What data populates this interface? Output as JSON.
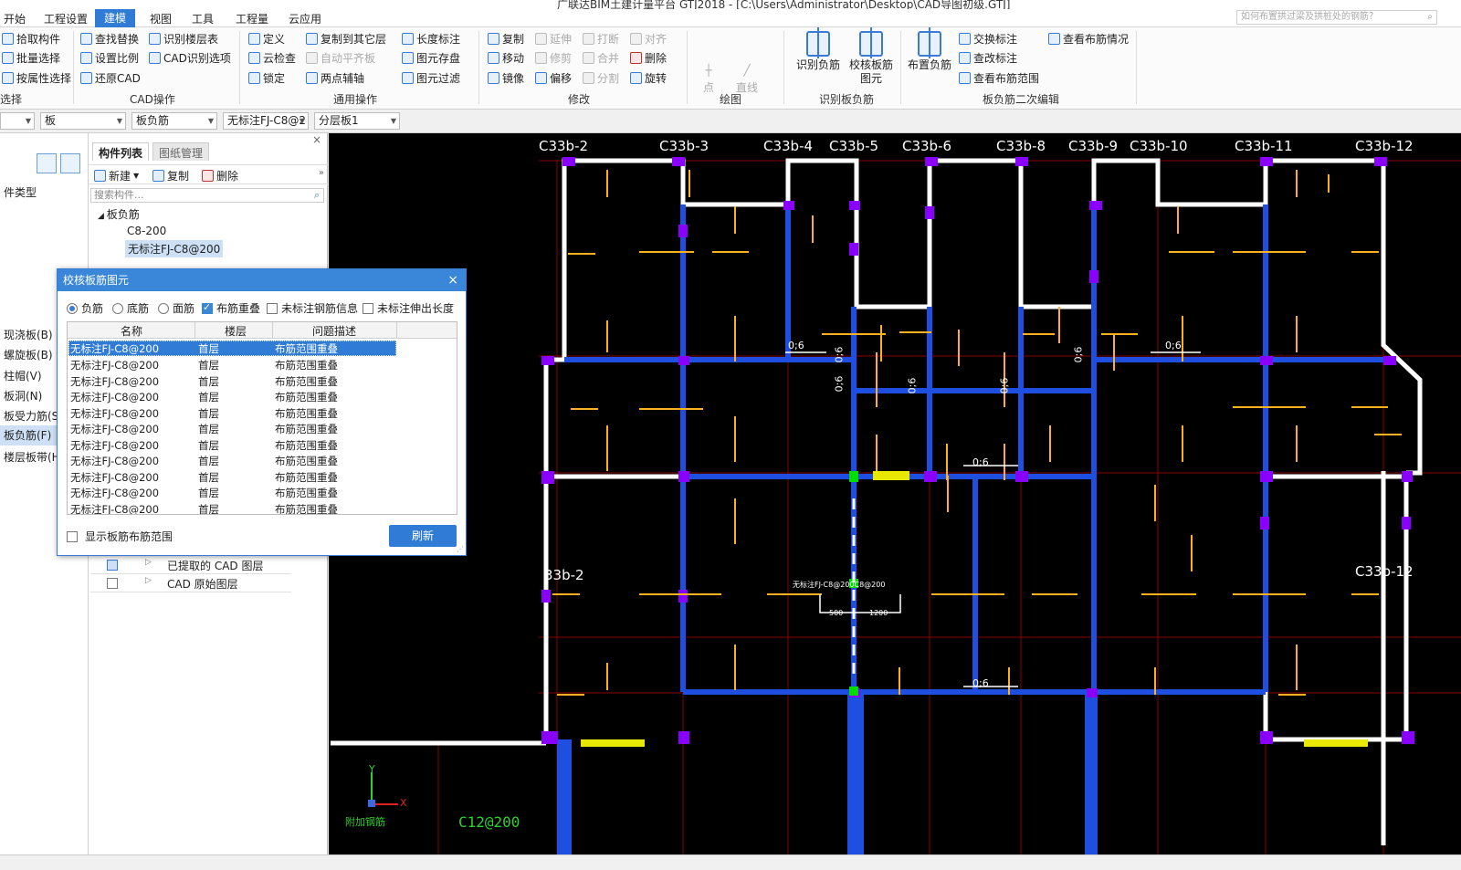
{
  "window": {
    "title": "广联达BIM土建计量平台 GTJ2018 - [C:\\Users\\Administrator\\Desktop\\CAD导图初级.GTJ]"
  },
  "menu": {
    "items": [
      "开始",
      "工程设置",
      "建模",
      "视图",
      "工具",
      "工程量",
      "云应用"
    ],
    "active": "建模",
    "search_placeholder": "如何布置拱过梁及拱桩处的钢筋？"
  },
  "ribbon": {
    "select_group": {
      "items": [
        "拾取构件",
        "批量选择",
        "按属性选择"
      ],
      "label": "选择"
    },
    "cad_group": {
      "items": [
        "查找替换",
        "识别楼层表",
        "设置比例",
        "CAD识别选项",
        "还原CAD"
      ],
      "label": "CAD操作"
    },
    "common_group": {
      "items": [
        "定义",
        "复制到其它层",
        "长度标注",
        "云检查",
        "自动平齐板",
        "图元存盘",
        "锁定",
        "两点辅轴",
        "图元过滤"
      ],
      "label": "通用操作"
    },
    "modify_group": {
      "items": [
        "复制",
        "延伸",
        "打断",
        "对齐",
        "移动",
        "修剪",
        "合并",
        "删除",
        "镜像",
        "偏移",
        "分割",
        "旋转"
      ],
      "label": "修改"
    },
    "draw_group": {
      "items": [
        "点",
        "直线"
      ],
      "label": "绘图"
    },
    "recognize_group": {
      "items": [
        "识别负筋",
        "校核板筋图元"
      ],
      "label": "识别板负筋"
    },
    "edit_group": {
      "items": [
        "布置负筋",
        "交换标注",
        "查看布筋情况",
        "查改标注",
        "查看布筋范围"
      ],
      "label": "板负筋二次编辑"
    }
  },
  "propbar": {
    "combos": [
      "",
      "板",
      "板负筋",
      "无标注FJ-C8@2",
      "分层板1"
    ]
  },
  "left_panel": {
    "header": "件类型",
    "items": [
      "现浇板(B)",
      "螺旋板(B)",
      "柱帽(V)",
      "板洞(N)",
      "板受力筋(S)",
      "板负筋(F)",
      "楼层板带(H)"
    ],
    "selected": "板负筋(F)"
  },
  "component_panel": {
    "tabs": [
      "构件列表",
      "图纸管理"
    ],
    "tools": [
      "新建",
      "复制",
      "删除"
    ],
    "search_placeholder": "搜索构件...",
    "tree_root": "板负筋",
    "tree_children": [
      "C8-200",
      "无标注FJ-C8@200"
    ],
    "selected": "无标注FJ-C8@200",
    "layers": [
      "已提取的 CAD 图层",
      "CAD 原始图层"
    ]
  },
  "dialog": {
    "title": "校核板筋图元",
    "options": [
      {
        "label": "负筋",
        "type": "radio",
        "checked": true
      },
      {
        "label": "底筋",
        "type": "radio",
        "checked": false
      },
      {
        "label": "面筋",
        "type": "radio",
        "checked": false
      },
      {
        "label": "布筋重叠",
        "type": "checkbox",
        "checked": true
      },
      {
        "label": "未标注钢筋信息",
        "type": "checkbox",
        "checked": false
      },
      {
        "label": "未标注伸出长度",
        "type": "checkbox",
        "checked": false
      }
    ],
    "columns": [
      "名称",
      "楼层",
      "问题描述"
    ],
    "rows": [
      [
        "无标注FJ-C8@200",
        "首层",
        "布筋范围重叠"
      ],
      [
        "无标注FJ-C8@200",
        "首层",
        "布筋范围重叠"
      ],
      [
        "无标注FJ-C8@200",
        "首层",
        "布筋范围重叠"
      ],
      [
        "无标注FJ-C8@200",
        "首层",
        "布筋范围重叠"
      ],
      [
        "无标注FJ-C8@200",
        "首层",
        "布筋范围重叠"
      ],
      [
        "无标注FJ-C8@200",
        "首层",
        "布筋范围重叠"
      ],
      [
        "无标注FJ-C8@200",
        "首层",
        "布筋范围重叠"
      ],
      [
        "无标注FJ-C8@200",
        "首层",
        "布筋范围重叠"
      ],
      [
        "无标注FJ-C8@200",
        "首层",
        "布筋范围重叠"
      ],
      [
        "无标注FJ-C8@200",
        "首层",
        "布筋范围重叠"
      ],
      [
        "无标注FJ-C8@200",
        "首层",
        "布筋范围重叠"
      ]
    ],
    "selected_row": 0,
    "show_range_label": "显示板筋布筋范围",
    "show_range_checked": false,
    "refresh_label": "刷新"
  },
  "canvas": {
    "axis_labels_top": [
      "C33b-2",
      "C33b-3",
      "C33b-4",
      "C33b-5",
      "C33b-6",
      "C33b-8",
      "C33b-9",
      "C33b-10",
      "C33b-11",
      "C33b-12"
    ],
    "axis_label_left_mid": "33b-2",
    "axis_label_right_mid": "C33b-12",
    "dim_labels": [
      "0;6",
      "0;6",
      "0;6",
      "0;6",
      "0;6",
      "0;6",
      "0;6",
      "0;6",
      "0;6"
    ],
    "annotation": "无标注FJ-C8@200C8@200",
    "dim_500": "500",
    "dim_1200": "1200",
    "bottom_text": "C12@200",
    "corner_text": "附加钢筋",
    "ucs_x": "X",
    "ucs_y": "Y",
    "colors": {
      "background": "#000000",
      "beam": "#1f4fe0",
      "wall": "#ffffff",
      "column": "#8a00ff",
      "rebar": "#ffb020",
      "grid": "#a00000"
    }
  }
}
